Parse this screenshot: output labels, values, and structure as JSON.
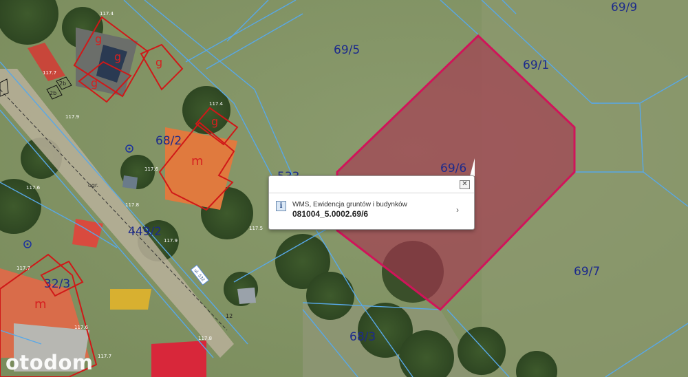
{
  "map": {
    "parcels": {
      "p69_5": "69/5",
      "p69_9": "69/9",
      "p69_1": "69/1",
      "p69_6": "69/6",
      "p68_2": "68/2",
      "p449_2": "449/2",
      "p32_3": "32/3",
      "p68_3": "68/3",
      "p69_7": "69/7",
      "p533": "533"
    },
    "buildings": {
      "g1": "g",
      "g2": "g",
      "g3": "g",
      "g4": "g",
      "g5": "g",
      "m1": "m",
      "m2": "m"
    },
    "elevations": {
      "e1": "117.4",
      "e2": "117.4",
      "e3": "117.9",
      "e4": "117.6",
      "e5": "117.6",
      "e6": "117.8",
      "e7": "117.9",
      "e8": "117.5",
      "e9": "117.7",
      "e10": "117.6",
      "e11": "117.8",
      "e12": "117.7",
      "e13": "117.7"
    },
    "small_labels": {
      "s1": "2b",
      "s2": "2b",
      "s3": "ogr.",
      "s4": "12"
    },
    "road_label": "ul. 532"
  },
  "popup": {
    "close_icon": "close-icon",
    "info_icon": "i",
    "layer_name": "WMS, Ewidencja gruntów i budynków",
    "parcel_id": "081004_5.0002.69/6",
    "chevron": "›"
  },
  "watermark": "otodom",
  "colors": {
    "selection_stroke": "#d0145a",
    "selection_fill": "#a8324f",
    "parcel_line": "#58a8e8",
    "building_line": "#d01818",
    "parcel_label": "#1c2a8c"
  }
}
